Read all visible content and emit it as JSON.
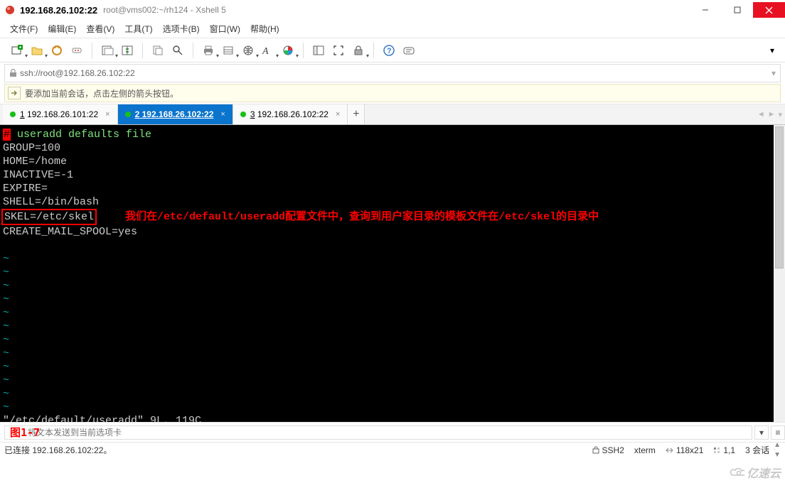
{
  "titlebar": {
    "main": "192.168.26.102:22",
    "sub": "root@vms002:~/rh124 - Xshell 5"
  },
  "menubar": [
    "文件(F)",
    "编辑(E)",
    "查看(V)",
    "工具(T)",
    "选项卡(B)",
    "窗口(W)",
    "帮助(H)"
  ],
  "address_url": "ssh://root@192.168.26.102:22",
  "infobar_text": "要添加当前会话，点击左侧的箭头按钮。",
  "tabs": [
    {
      "num": "1",
      "label": "192.168.26.101:22",
      "active": false
    },
    {
      "num": "2",
      "label": "192.168.26.102:22",
      "active": true
    },
    {
      "num": "3",
      "label": "192.168.26.102:22",
      "active": false
    }
  ],
  "terminal": {
    "comment_line": " useradd defaults file",
    "lines": [
      "GROUP=100",
      "HOME=/home",
      "INACTIVE=-1",
      "EXPIRE=",
      "SHELL=/bin/bash"
    ],
    "skel_line": "SKEL=/etc/skel",
    "annotation": "我们在/etc/default/useradd配置文件中，查询到用户家目录的模板文件在/etc/skel的目录中",
    "line_after": "CREATE_MAIL_SPOOL=yes",
    "status_line": "\"/etc/default/useradd\" 9L, 119C"
  },
  "figure_label": "图1-7",
  "send_placeholder": "将文本发送到当前选项卡",
  "statusbar": {
    "connected": "已连接 192.168.26.102:22。",
    "ssh": "SSH2",
    "term": "xterm",
    "size": "118x21",
    "pos": "1,1",
    "sessions": "3 会话"
  },
  "watermark": "亿速云"
}
